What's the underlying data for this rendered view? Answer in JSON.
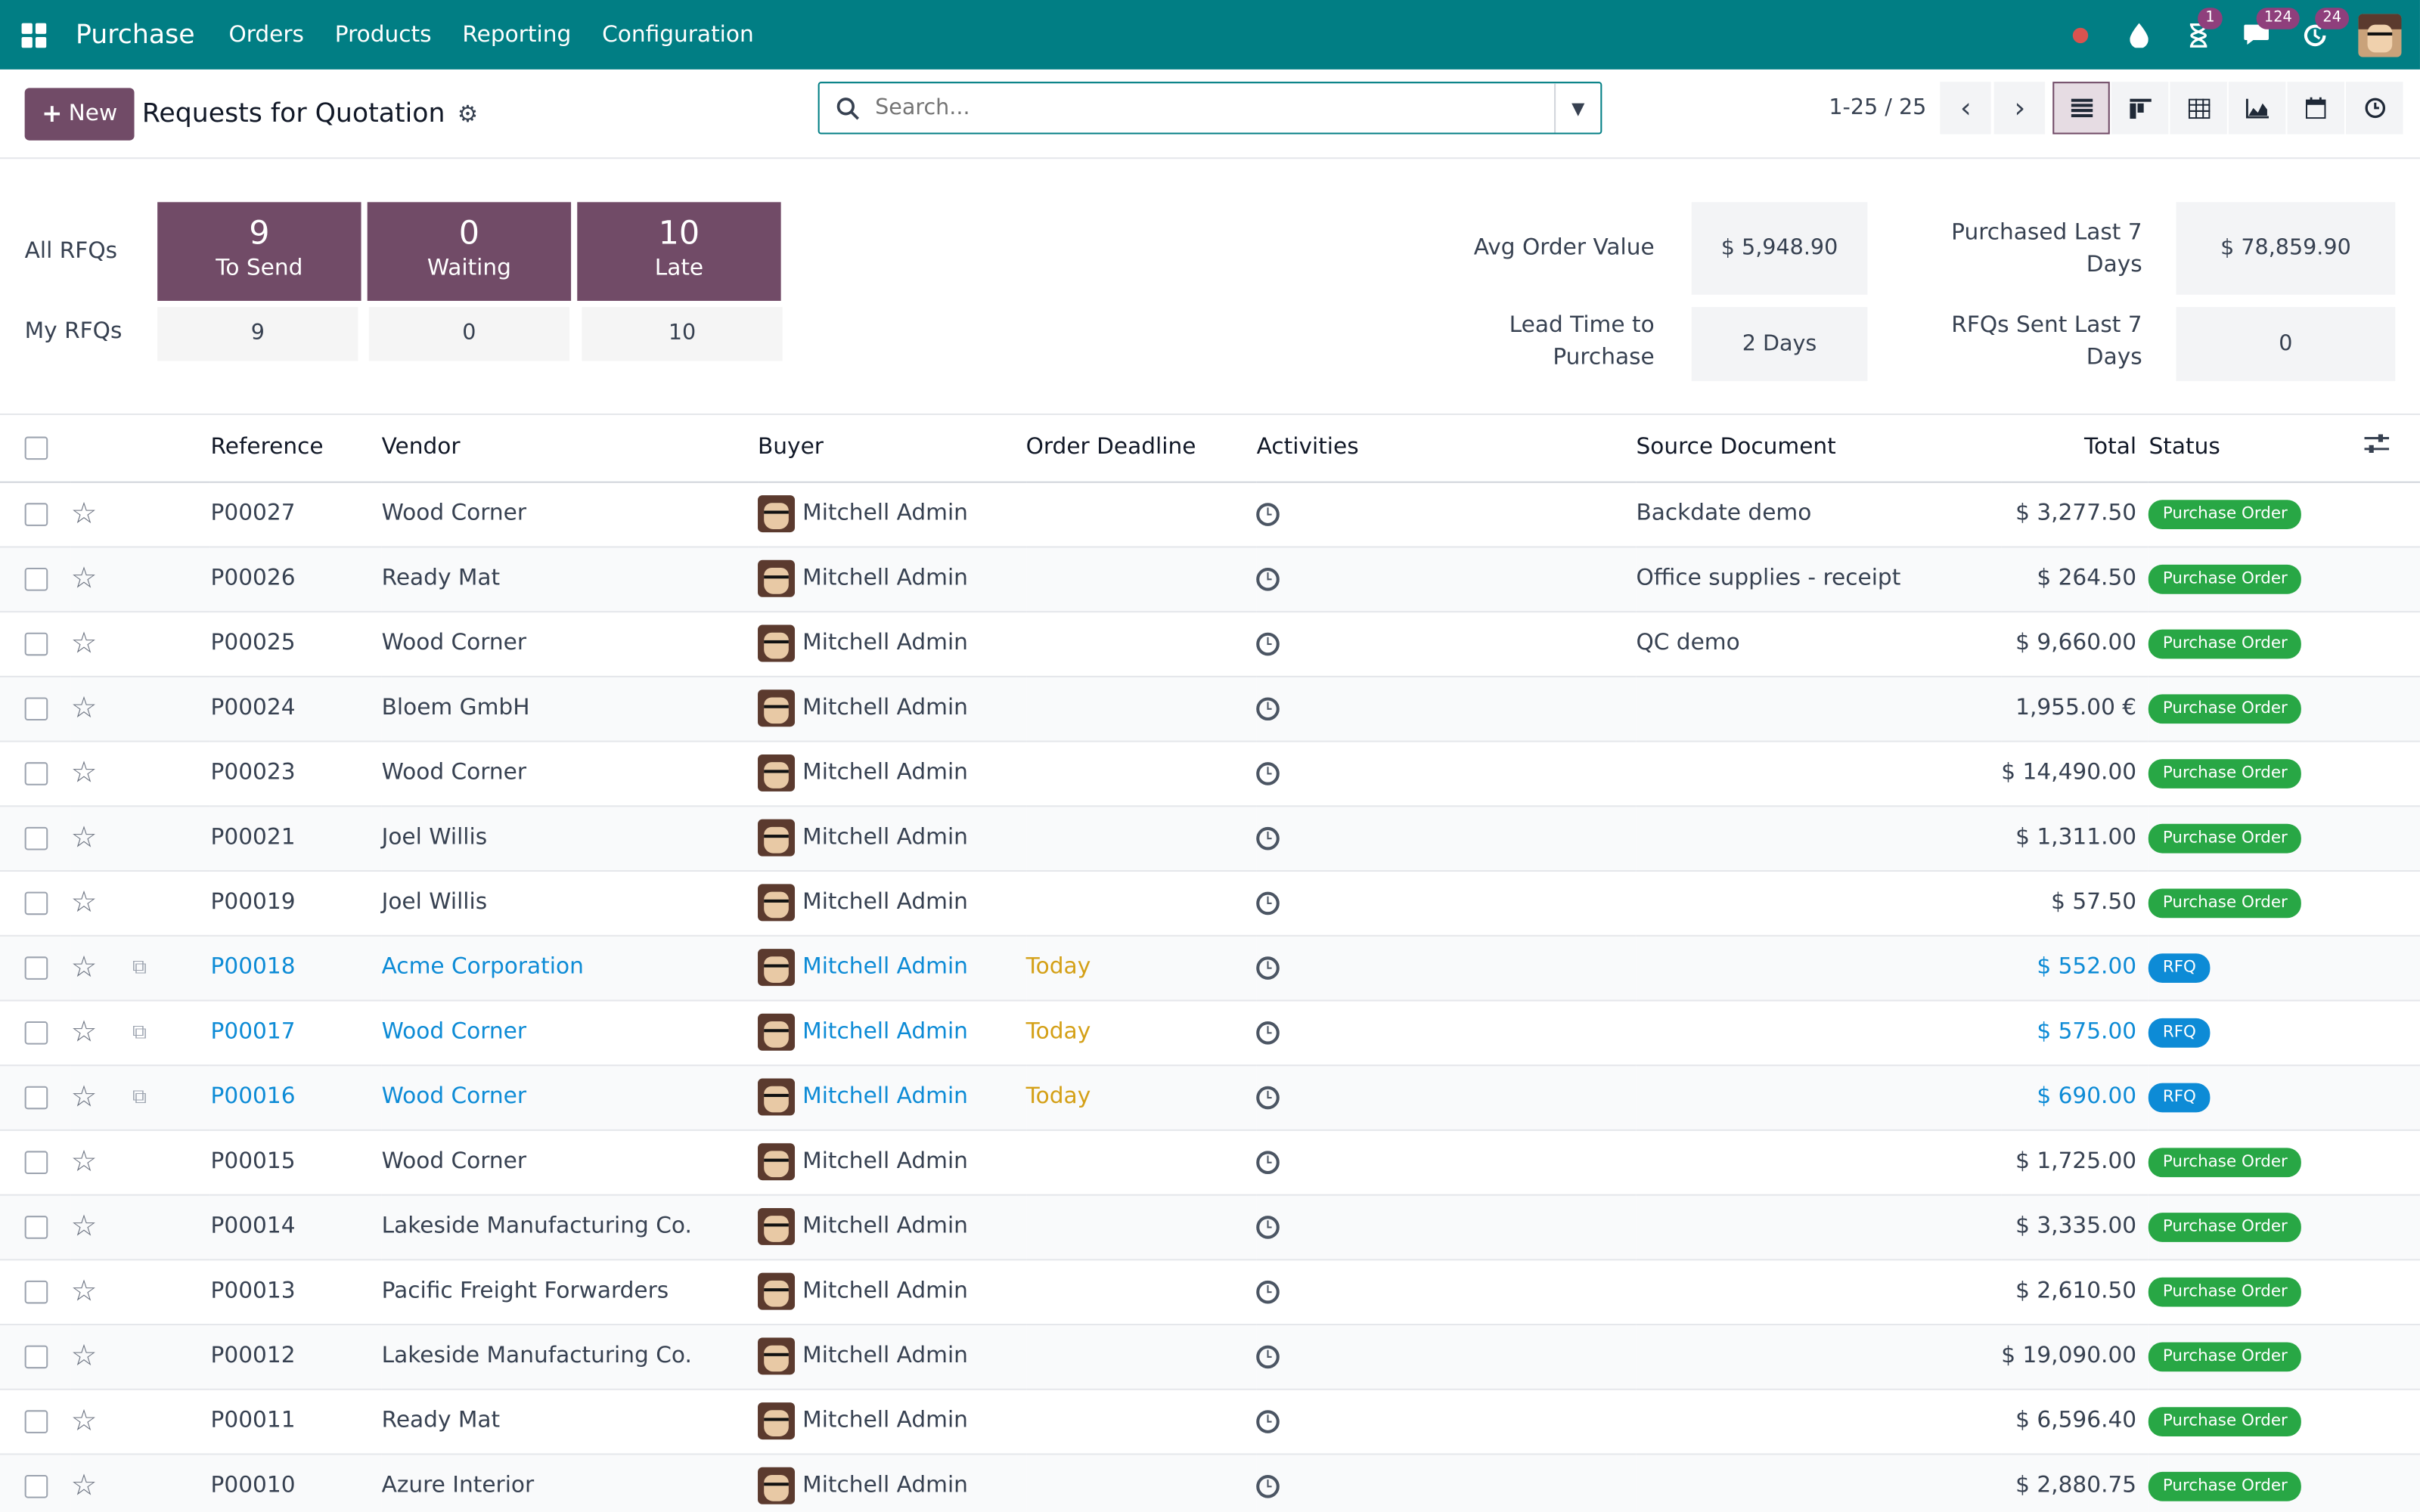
{
  "nav": {
    "app_name": "Purchase",
    "menu": [
      "Orders",
      "Products",
      "Reporting",
      "Configuration"
    ],
    "badges": {
      "activity": "1",
      "messages": "124",
      "updates": "24"
    }
  },
  "control": {
    "new_label": "New",
    "title": "Requests for Quotation",
    "search_placeholder": "Search...",
    "pager": "1-25 / 25"
  },
  "dashboard": {
    "all_rfqs_label": "All RFQs",
    "my_rfqs_label": "My RFQs",
    "tiles": [
      {
        "count": "9",
        "label": "To Send",
        "mine": "9"
      },
      {
        "count": "0",
        "label": "Waiting",
        "mine": "0"
      },
      {
        "count": "10",
        "label": "Late",
        "mine": "10"
      }
    ],
    "stats": {
      "avg_order_label": "Avg Order Value",
      "avg_order_value": "$ 5,948.90",
      "lead_time_label_1": "Lead Time to",
      "lead_time_label_2": "Purchase",
      "lead_time_value": "2  Days",
      "purchased_label_1": "Purchased Last 7",
      "purchased_label_2": "Days",
      "purchased_value": "$ 78,859.90",
      "sent_label_1": "RFQs Sent Last 7",
      "sent_label_2": "Days",
      "sent_value": "0"
    }
  },
  "table": {
    "headers": {
      "reference": "Reference",
      "vendor": "Vendor",
      "buyer": "Buyer",
      "deadline": "Order Deadline",
      "activities": "Activities",
      "source": "Source Document",
      "total": "Total",
      "status": "Status"
    },
    "rows": [
      {
        "ref": "P00027",
        "vendor": "Wood Corner",
        "buyer": "Mitchell Admin",
        "deadline": "",
        "source": "Backdate demo",
        "total": "$ 3,277.50",
        "status": "Purchase Order"
      },
      {
        "ref": "P00026",
        "vendor": "Ready Mat",
        "buyer": "Mitchell Admin",
        "deadline": "",
        "source": "Office supplies - receipt",
        "total": "$ 264.50",
        "status": "Purchase Order"
      },
      {
        "ref": "P00025",
        "vendor": "Wood Corner",
        "buyer": "Mitchell Admin",
        "deadline": "",
        "source": "QC demo",
        "total": "$ 9,660.00",
        "status": "Purchase Order"
      },
      {
        "ref": "P00024",
        "vendor": "Bloem GmbH",
        "buyer": "Mitchell Admin",
        "deadline": "",
        "source": "",
        "total": "1,955.00 €",
        "status": "Purchase Order"
      },
      {
        "ref": "P00023",
        "vendor": "Wood Corner",
        "buyer": "Mitchell Admin",
        "deadline": "",
        "source": "",
        "total": "$ 14,490.00",
        "status": "Purchase Order"
      },
      {
        "ref": "P00021",
        "vendor": "Joel Willis",
        "buyer": "Mitchell Admin",
        "deadline": "",
        "source": "",
        "total": "$ 1,311.00",
        "status": "Purchase Order"
      },
      {
        "ref": "P00019",
        "vendor": "Joel Willis",
        "buyer": "Mitchell Admin",
        "deadline": "",
        "source": "",
        "total": "$ 57.50",
        "status": "Purchase Order"
      },
      {
        "ref": "P00018",
        "vendor": "Acme Corporation",
        "buyer": "Mitchell Admin",
        "deadline": "Today",
        "source": "",
        "total": "$ 552.00",
        "status": "RFQ"
      },
      {
        "ref": "P00017",
        "vendor": "Wood Corner",
        "buyer": "Mitchell Admin",
        "deadline": "Today",
        "source": "",
        "total": "$ 575.00",
        "status": "RFQ"
      },
      {
        "ref": "P00016",
        "vendor": "Wood Corner",
        "buyer": "Mitchell Admin",
        "deadline": "Today",
        "source": "",
        "total": "$ 690.00",
        "status": "RFQ"
      },
      {
        "ref": "P00015",
        "vendor": "Wood Corner",
        "buyer": "Mitchell Admin",
        "deadline": "",
        "source": "",
        "total": "$ 1,725.00",
        "status": "Purchase Order"
      },
      {
        "ref": "P00014",
        "vendor": "Lakeside Manufacturing Co.",
        "buyer": "Mitchell Admin",
        "deadline": "",
        "source": "",
        "total": "$ 3,335.00",
        "status": "Purchase Order"
      },
      {
        "ref": "P00013",
        "vendor": "Pacific Freight Forwarders",
        "buyer": "Mitchell Admin",
        "deadline": "",
        "source": "",
        "total": "$ 2,610.50",
        "status": "Purchase Order"
      },
      {
        "ref": "P00012",
        "vendor": "Lakeside Manufacturing Co.",
        "buyer": "Mitchell Admin",
        "deadline": "",
        "source": "",
        "total": "$ 19,090.00",
        "status": "Purchase Order"
      },
      {
        "ref": "P00011",
        "vendor": "Ready Mat",
        "buyer": "Mitchell Admin",
        "deadline": "",
        "source": "",
        "total": "$ 6,596.40",
        "status": "Purchase Order"
      },
      {
        "ref": "P00010",
        "vendor": "Azure Interior",
        "buyer": "Mitchell Admin",
        "deadline": "",
        "source": "",
        "total": "$ 2,880.75",
        "status": "Purchase Order"
      }
    ]
  },
  "colors": {
    "topbar": "#017e84",
    "primary": "#714b67",
    "po_badge": "#28a745",
    "rfq_badge": "#0d8bd6",
    "link": "#0d8bd6",
    "today": "#d4a017"
  }
}
